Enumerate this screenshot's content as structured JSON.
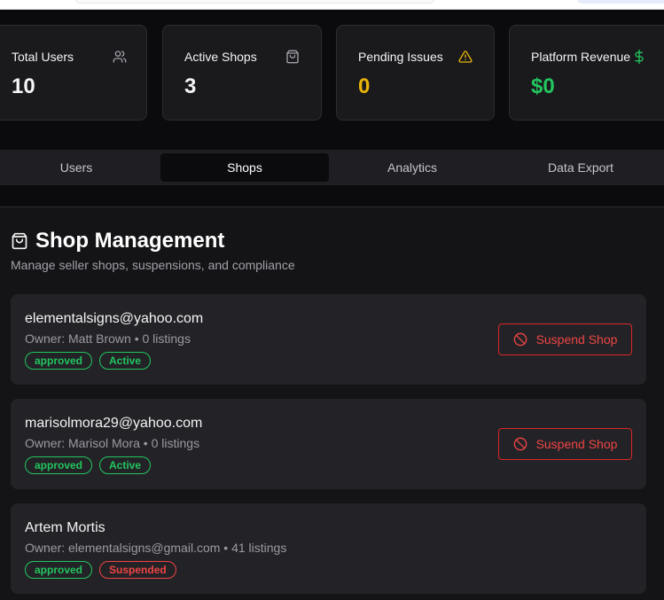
{
  "stats": [
    {
      "label": "Total Users",
      "value": "10",
      "icon": "users-icon",
      "color": "#f4f4f5"
    },
    {
      "label": "Active Shops",
      "value": "3",
      "icon": "shopping-bag-icon",
      "color": "#f4f4f5"
    },
    {
      "label": "Pending Issues",
      "value": "0",
      "icon": "alert-triangle-icon",
      "color": "#eab308"
    },
    {
      "label": "Platform Revenue",
      "value": "$0",
      "icon": "dollar-icon",
      "color": "#22c55e"
    }
  ],
  "tabs": [
    {
      "label": "Users",
      "active": false
    },
    {
      "label": "Shops",
      "active": true
    },
    {
      "label": "Analytics",
      "active": false
    },
    {
      "label": "Data Export",
      "active": false
    }
  ],
  "shop_management": {
    "title": "Shop Management",
    "description": "Manage seller shops, suspensions, and compliance",
    "icon": "shopping-bag-icon",
    "suspend_label": "Suspend Shop",
    "shops": [
      {
        "name": "elementalsigns@yahoo.com",
        "owner": "Owner: Matt Brown • 0 listings",
        "badges": [
          "approved",
          "Active"
        ],
        "has_suspend_button": true
      },
      {
        "name": "marisolmora29@yahoo.com",
        "owner": "Owner: Marisol Mora • 0 listings",
        "badges": [
          "approved",
          "Active"
        ],
        "has_suspend_button": true
      },
      {
        "name": "Artem Mortis",
        "owner": "Owner: elementalsigns@gmail.com • 41 listings",
        "badges": [
          "approved",
          "Suspended"
        ],
        "has_suspend_button": false
      }
    ]
  },
  "colors": {
    "accent_green": "#22c55e",
    "accent_red": "#ef4444",
    "accent_yellow": "#eab308"
  }
}
